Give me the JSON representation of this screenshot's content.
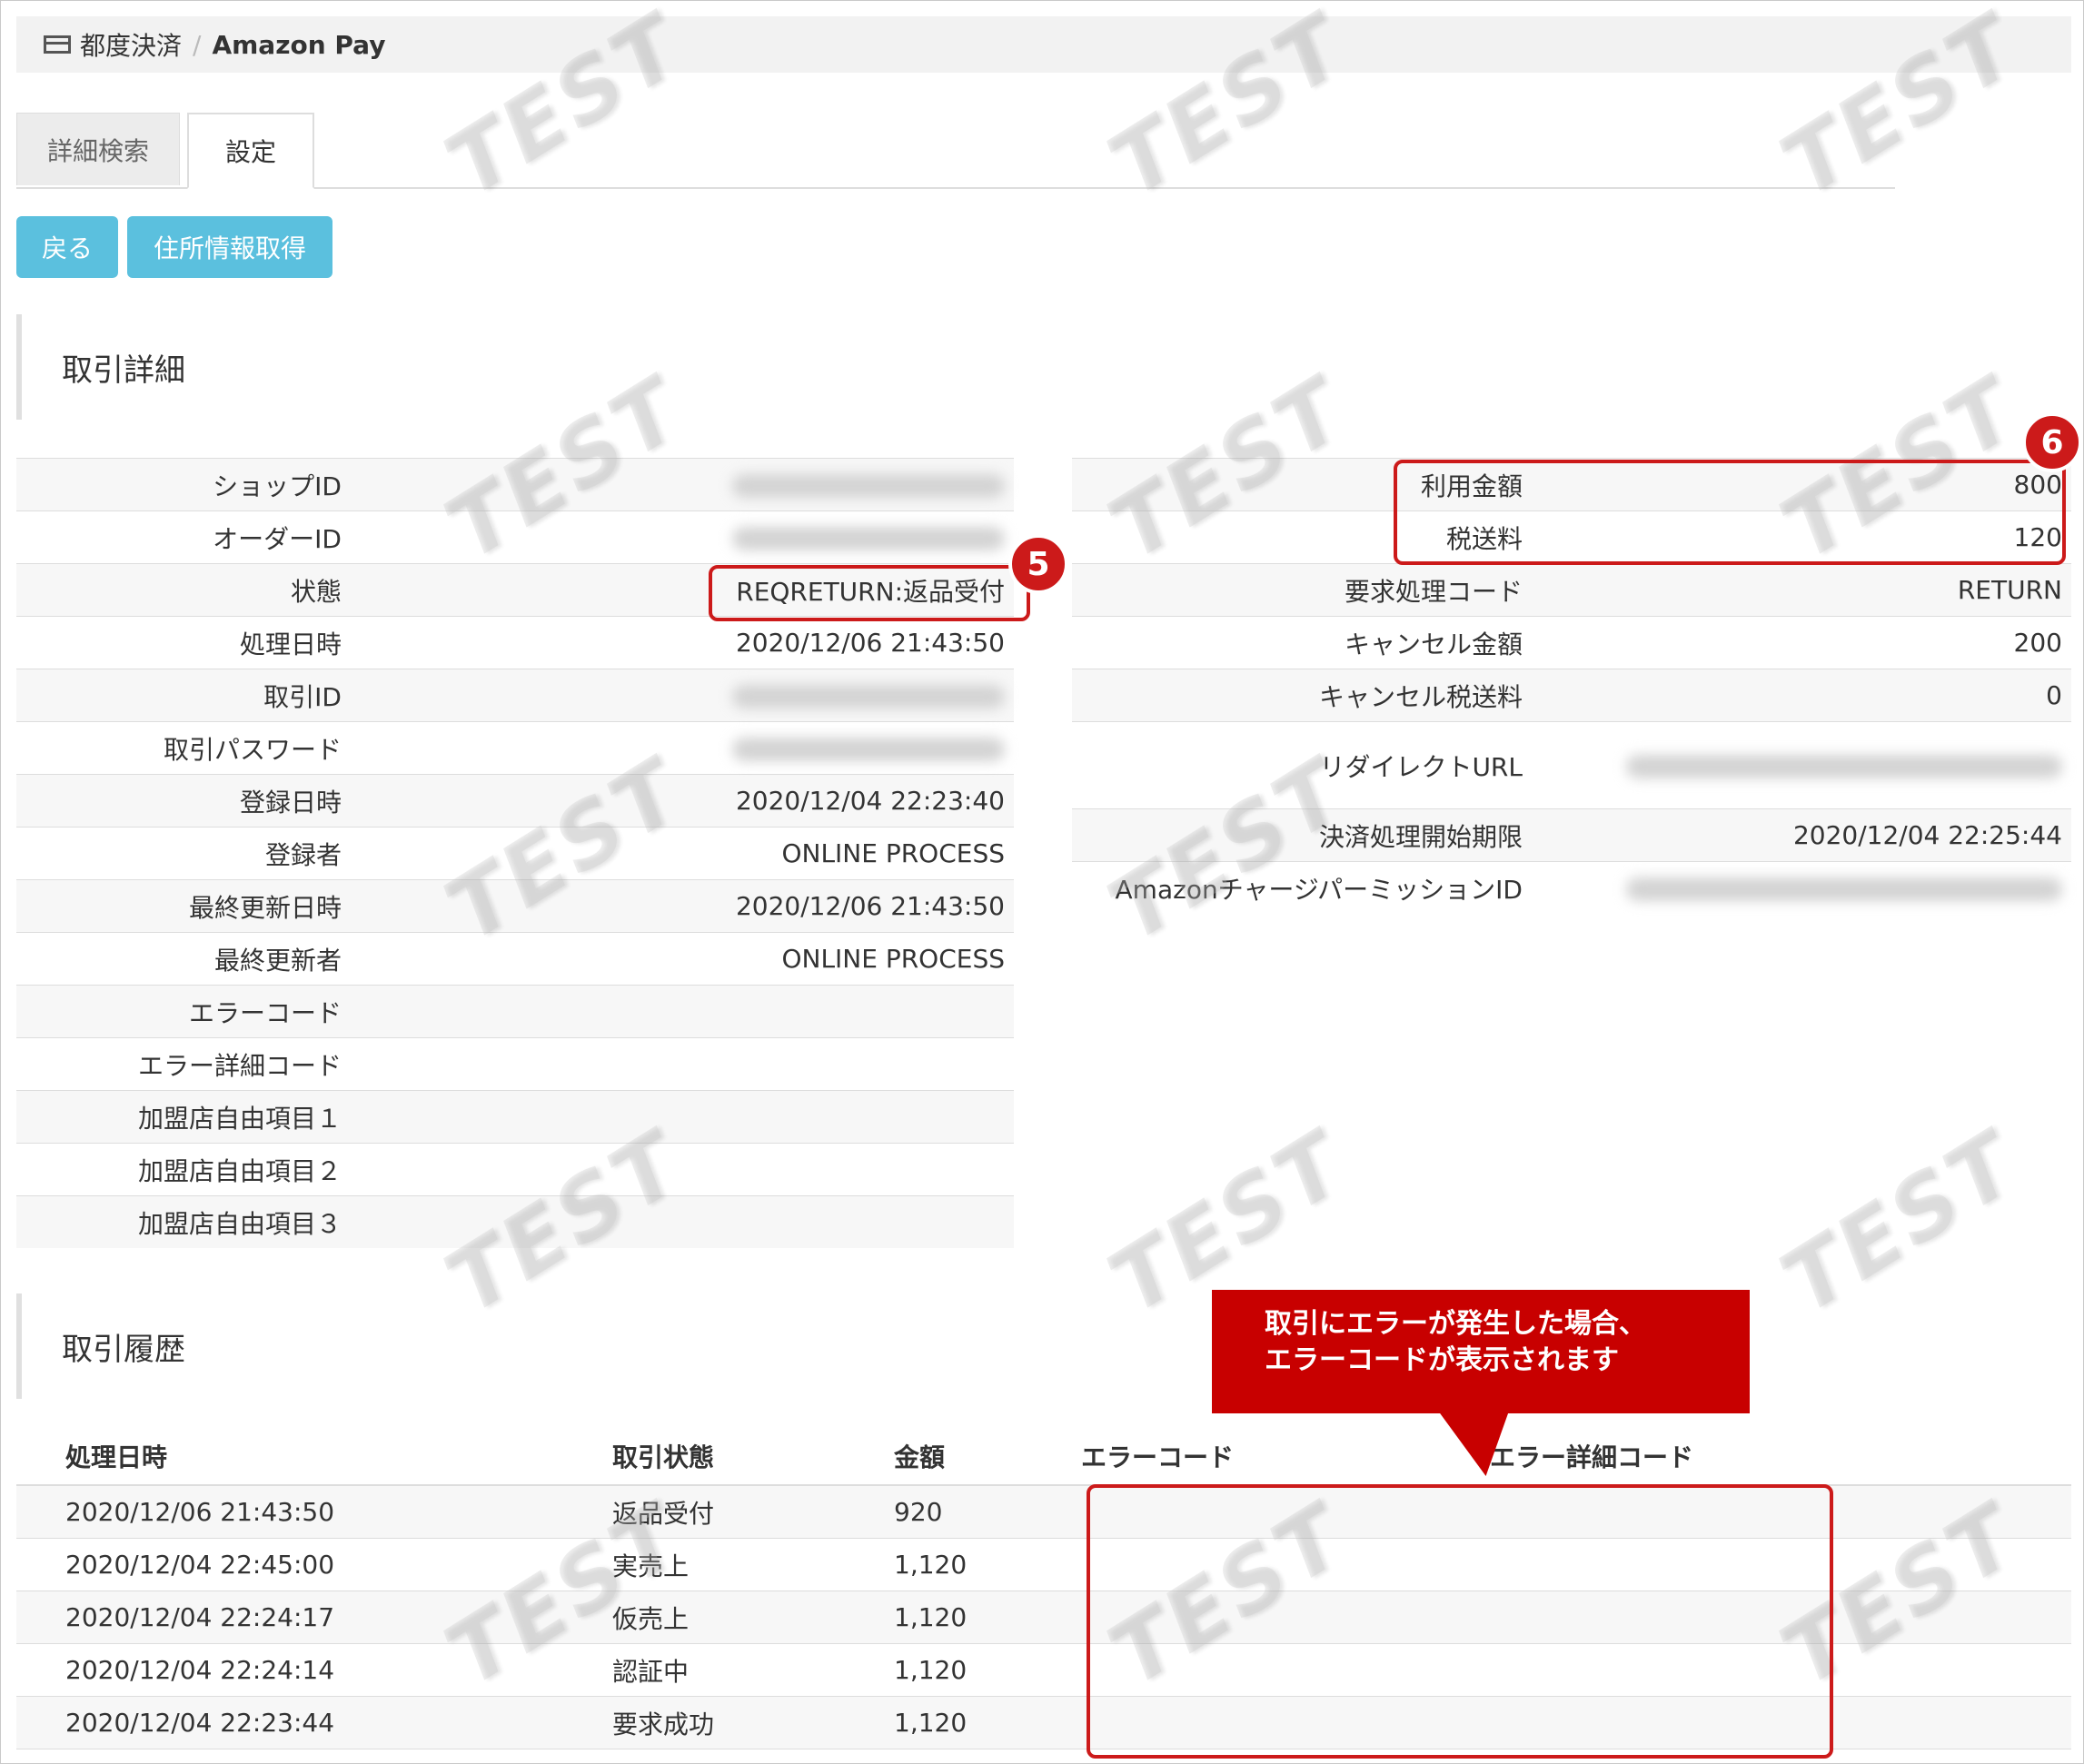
{
  "breadcrumb": {
    "parent": "都度決済",
    "separator": "/",
    "current": "Amazon Pay"
  },
  "tabs": [
    {
      "label": "詳細検索"
    },
    {
      "label": "設定"
    }
  ],
  "buttons": {
    "back": "戻る",
    "get_address": "住所情報取得"
  },
  "watermark": "TEST",
  "detail": {
    "title": "取引詳細",
    "left": [
      {
        "label": "ショップID",
        "value": "",
        "blurred": true
      },
      {
        "label": "オーダーID",
        "value": "",
        "blurred": true
      },
      {
        "label": "状態",
        "value": "REQRETURN:返品受付"
      },
      {
        "label": "処理日時",
        "value": "2020/12/06 21:43:50"
      },
      {
        "label": "取引ID",
        "value": "",
        "blurred": true
      },
      {
        "label": "取引パスワード",
        "value": "",
        "blurred": true
      },
      {
        "label": "登録日時",
        "value": "2020/12/04 22:23:40"
      },
      {
        "label": "登録者",
        "value": "ONLINE PROCESS"
      },
      {
        "label": "最終更新日時",
        "value": "2020/12/06 21:43:50"
      },
      {
        "label": "最終更新者",
        "value": "ONLINE PROCESS"
      },
      {
        "label": "エラーコード",
        "value": ""
      },
      {
        "label": "エラー詳細コード",
        "value": ""
      },
      {
        "label": "加盟店自由項目１",
        "value": ""
      },
      {
        "label": "加盟店自由項目２",
        "value": ""
      },
      {
        "label": "加盟店自由項目３",
        "value": ""
      }
    ],
    "right": [
      {
        "label": "利用金額",
        "value": "800"
      },
      {
        "label": "税送料",
        "value": "120"
      },
      {
        "label": "要求処理コード",
        "value": "RETURN"
      },
      {
        "label": "キャンセル金額",
        "value": "200"
      },
      {
        "label": "キャンセル税送料",
        "value": "0"
      },
      {
        "label": "リダイレクトURL",
        "value": "",
        "blurred": true
      },
      {
        "label": "決済処理開始期限",
        "value": "2020/12/04 22:25:44"
      },
      {
        "label": "AmazonチャージパーミッションID",
        "value": "",
        "blurred": true
      }
    ]
  },
  "annotations": {
    "badge5": "5",
    "badge6": "6",
    "callout_line1": "取引にエラーが発生した場合、",
    "callout_line2": "エラーコードが表示されます"
  },
  "history": {
    "title": "取引履歴",
    "columns": [
      "処理日時",
      "取引状態",
      "金額",
      "エラーコード",
      "エラー詳細コード"
    ],
    "rows": [
      [
        "2020/12/06 21:43:50",
        "返品受付",
        "920",
        "",
        ""
      ],
      [
        "2020/12/04 22:45:00",
        "実売上",
        "1,120",
        "",
        ""
      ],
      [
        "2020/12/04 22:24:17",
        "仮売上",
        "1,120",
        "",
        ""
      ],
      [
        "2020/12/04 22:24:14",
        "認証中",
        "1,120",
        "",
        ""
      ],
      [
        "2020/12/04 22:23:44",
        "要求成功",
        "1,120",
        "",
        ""
      ]
    ]
  }
}
